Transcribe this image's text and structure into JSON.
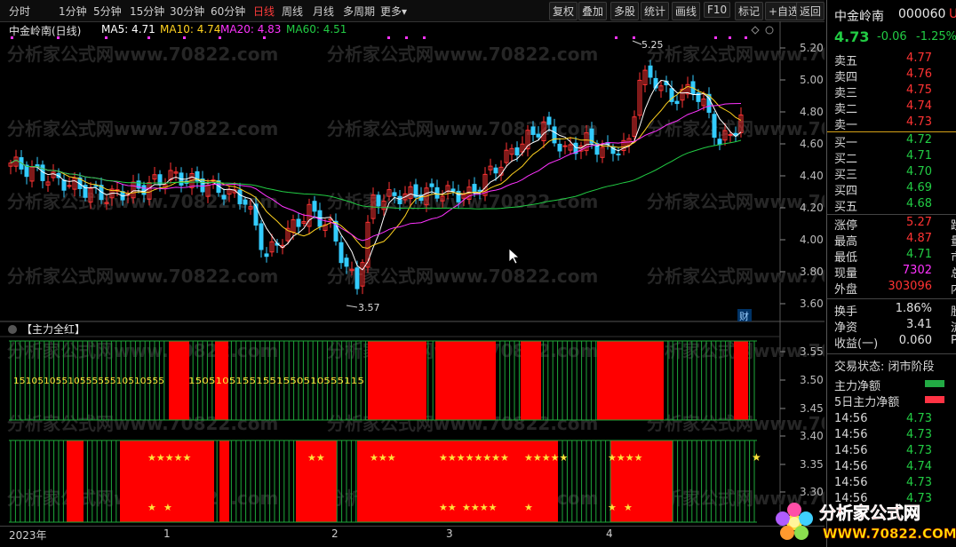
{
  "toolbar": {
    "periods": [
      "分时",
      "1分钟",
      "5分钟",
      "15分钟",
      "30分钟",
      "60分钟",
      "日线",
      "周线",
      "月线",
      "多周期",
      "更多"
    ],
    "more_arrow": "▾",
    "active_period": "日线",
    "tools": [
      "复权",
      "叠加",
      "多股",
      "统计",
      "画线",
      "F10",
      "标记",
      "+自选",
      "返回"
    ]
  },
  "chart": {
    "stock_label": "中金岭南(日线)",
    "ma": [
      {
        "label": "MA5: 4.71",
        "color": "#ffffff"
      },
      {
        "label": "MA10: 4.74",
        "color": "#ffd21f"
      },
      {
        "label": "MA20: 4.83",
        "color": "#ff33ff"
      },
      {
        "label": "MA60: 4.51",
        "color": "#22cc44"
      }
    ],
    "price_axis": [
      "5.20",
      "5.00",
      "4.80",
      "4.60",
      "4.40",
      "4.20",
      "4.00",
      "3.80",
      "3.60"
    ],
    "high_label": "5.25",
    "low_label": "3.57",
    "fin_badge": "财",
    "indicator_title": "【主力全红】",
    "sub_axis": [
      "3.55",
      "3.50",
      "3.45",
      "3.40",
      "3.35",
      "3.30"
    ],
    "digit_groups": [
      "1510510551055555510510555",
      "15051051551551550510555115"
    ],
    "stars_top_groups": [
      "★★★★★",
      "★★",
      "★★★",
      "★★★★★★★★",
      "★★★★★",
      "★★★★"
    ],
    "stars_bottom_groups": [
      "★",
      "★",
      "★★",
      "★★★★",
      "★",
      "★",
      "★"
    ],
    "star_right": "★",
    "x_axis": [
      "2023年",
      "1",
      "2",
      "3",
      "4"
    ],
    "watermark": "分析家公式网www.70822.com"
  },
  "panel": {
    "name": "中金岭南",
    "code": "000060",
    "name_cut": "U",
    "price": "4.73",
    "change": "-0.06",
    "change_pct": "-1.25%",
    "asks": [
      {
        "label": "卖五",
        "price": "4.77"
      },
      {
        "label": "卖四",
        "price": "4.76"
      },
      {
        "label": "卖三",
        "price": "4.75"
      },
      {
        "label": "卖二",
        "price": "4.74"
      },
      {
        "label": "卖一",
        "price": "4.73"
      }
    ],
    "bids": [
      {
        "label": "买一",
        "price": "4.72"
      },
      {
        "label": "买二",
        "price": "4.71"
      },
      {
        "label": "买三",
        "price": "4.70"
      },
      {
        "label": "买四",
        "price": "4.69"
      },
      {
        "label": "买五",
        "price": "4.68"
      }
    ],
    "stats": [
      {
        "label": "涨停",
        "value": "5.27",
        "color": "red",
        "cut": "跌"
      },
      {
        "label": "最高",
        "value": "4.87",
        "color": "red",
        "cut": "量"
      },
      {
        "label": "最低",
        "value": "4.71",
        "color": "green",
        "cut": "市"
      },
      {
        "label": "现量",
        "value": "7302",
        "color": "magenta",
        "cut": "总"
      },
      {
        "label": "外盘",
        "value": "303096",
        "color": "red",
        "cut": "内"
      }
    ],
    "stats2": [
      {
        "label": "换手",
        "value": "1.86%",
        "cut": "股"
      },
      {
        "label": "净资",
        "value": "3.41",
        "cut": "流"
      },
      {
        "label": "收益(一)",
        "value": "0.060",
        "cut": "P"
      }
    ],
    "trade_status": "交易状态: 闭市阶段",
    "legend": [
      {
        "label": "主力净额",
        "color": "#22aa44"
      },
      {
        "label": "5日主力净额",
        "color": "#ff3344"
      }
    ],
    "ticks": [
      {
        "time": "14:56",
        "price": "4.73"
      },
      {
        "time": "14:56",
        "price": "4.73"
      },
      {
        "time": "14:56",
        "price": "4.73"
      },
      {
        "time": "14:56",
        "price": "4.74"
      },
      {
        "time": "14:56",
        "price": "4.73"
      },
      {
        "time": "14:56",
        "price": "4.73"
      }
    ]
  },
  "brand": {
    "title": "分析家公式网",
    "url": "WWW.70822.COM"
  }
}
